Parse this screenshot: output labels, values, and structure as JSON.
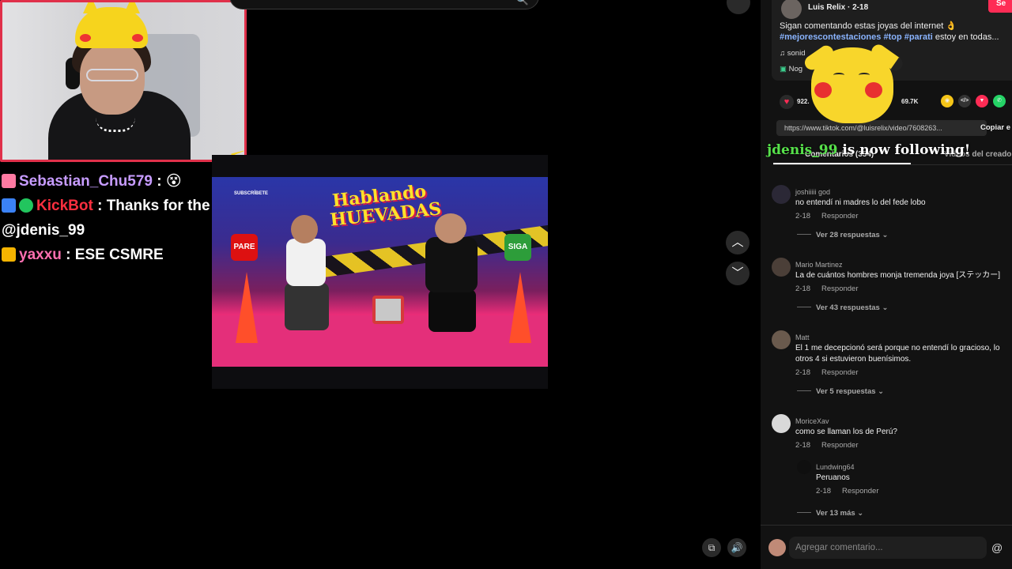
{
  "overlay": {
    "chat": [
      {
        "user": "Sebastian_Chu579",
        "separator": ":",
        "message": ""
      },
      {
        "user": "KickBot",
        "separator": ":",
        "message": "Thanks for the follow"
      },
      {
        "user": "",
        "separator": "",
        "message": "@jdenis_99"
      },
      {
        "user": "yaxxu",
        "separator": ":",
        "message": "ESE CSMRE"
      }
    ],
    "follow_alert": {
      "name": "jdenis_99",
      "text": " is now following!"
    }
  },
  "video": {
    "logo_line1": "Hablando",
    "logo_line2": "HUEVADAS",
    "subscribe_label": "SUBSCRÍBETE",
    "stop_sign": "PARE",
    "go_sign": "SIGA"
  },
  "post": {
    "author": "Luis Relix · 2-18",
    "follow_label": "Se",
    "description": "Sigan comentando estas joyas del internet 👌",
    "hashtags": "#mejorescontestaciones #top #parati",
    "description_tail": " estoy en todas...",
    "music": "sonid",
    "nogo_label": "Nog",
    "likes": "922.",
    "saves": "69.7K",
    "url": "https://www.tiktok.com/@luisrelix/video/7608263...",
    "copy_label": "Copiar e"
  },
  "tabs": {
    "comments": "Comentarios (354)",
    "creator_videos": "Videos del creador"
  },
  "comments": [
    {
      "name": "joshiiiii god",
      "text": "no entendí ni madres lo del fede lobo",
      "date": "2-18",
      "reply": "Responder",
      "more": "Ver 28 respuestas"
    },
    {
      "name": "Mario Martinez",
      "text": "La de cuántos hombres monja tremenda joya [ステッカー]",
      "date": "2-18",
      "reply": "Responder",
      "more": "Ver 43 respuestas"
    },
    {
      "name": "Matt",
      "text": "El 1 me decepcionó será porque no entendí lo gracioso, lo",
      "text2": "otros 4 si estuvieron buenísimos.",
      "date": "2-18",
      "reply": "Responder",
      "more": "Ver 5 respuestas"
    },
    {
      "name": "MoriceXav",
      "text": "como se llaman los de Perú?",
      "date": "2-18",
      "reply": "Responder"
    }
  ],
  "reply": {
    "name": "Lundwing64",
    "text": "Peruanos",
    "date": "2-18",
    "reply": "Responder"
  },
  "more_last": "Ver 13 más",
  "composer": {
    "placeholder": "Agregar comentario...",
    "at": "@"
  }
}
